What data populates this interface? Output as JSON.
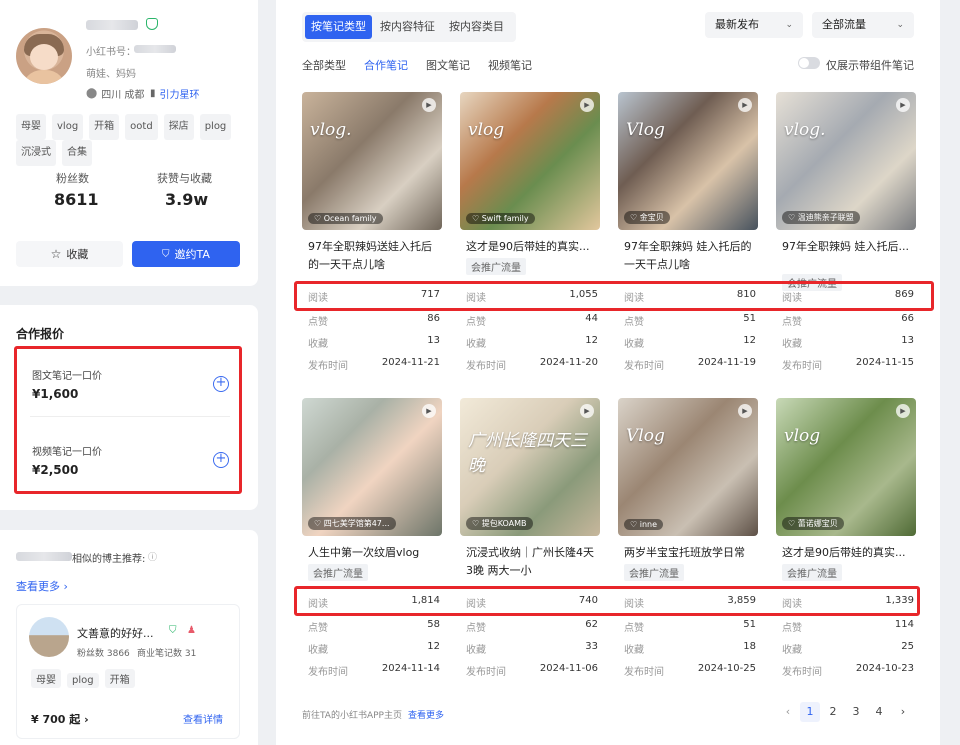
{
  "profile": {
    "id_label": "小红书号：",
    "bio": "萌娃、妈妈",
    "location": "四川 成都",
    "star_label": "引力星环",
    "tags": [
      "母婴",
      "vlog",
      "开箱",
      "ootd",
      "探店",
      "plog",
      "沉浸式",
      "合集"
    ],
    "fans_label": "粉丝数",
    "fans_value": "8611",
    "likes_label": "获赞与收藏",
    "likes_value": "3.9w",
    "collect_btn": "收藏",
    "invite_btn": "邀约TA"
  },
  "quote": {
    "title": "合作报价",
    "items": [
      {
        "label": "图文笔记一口价",
        "price": "¥1,600"
      },
      {
        "label": "视频笔记一口价",
        "price": "¥2,500"
      }
    ]
  },
  "recommend": {
    "title_suffix": "相似的博主推荐:",
    "see_more": "查看更多 ›",
    "blogger": {
      "name": "文善意的好好...",
      "fans": "粉丝数 3866",
      "notes": "商业笔记数 31",
      "tags": [
        "母婴",
        "plog",
        "开箱"
      ],
      "price": "¥ 700 起 ›",
      "details": "查看详情"
    }
  },
  "main": {
    "seg_tabs": [
      "按笔记类型",
      "按内容特征",
      "按内容类目"
    ],
    "sort_dropdown": "最新发布",
    "traffic_dropdown": "全部流量",
    "sub_tabs": [
      "全部类型",
      "合作笔记",
      "图文笔记",
      "视频笔记"
    ],
    "toggle_label": "仅展示带组件笔记",
    "stat_labels": [
      "阅读",
      "点赞",
      "收藏",
      "发布时间"
    ],
    "notes": [
      {
        "title": "97年全职辣妈送娃入托后的一天干点儿啥",
        "badge": "",
        "author": "Ocean family",
        "overlay": "vlog.",
        "read": "717",
        "like": "86",
        "fav": "13",
        "date": "2024-11-21"
      },
      {
        "title": "这才是90后带娃的真实...",
        "badge": "会推广流量",
        "author": "Swift family",
        "overlay": "vlog",
        "read": "1,055",
        "like": "44",
        "fav": "12",
        "date": "2024-11-20"
      },
      {
        "title": "97年全职辣妈 娃入托后的一天干点儿啥",
        "badge": "",
        "author": "金宝贝",
        "overlay": "Vlog",
        "read": "810",
        "like": "51",
        "fav": "12",
        "date": "2024-11-19"
      },
      {
        "title": "97年全职辣妈 娃入托后...",
        "badge": "会推广流量",
        "author": "温迪熊亲子联盟",
        "overlay": "vlog.",
        "read": "869",
        "like": "66",
        "fav": "13",
        "date": "2024-11-15"
      },
      {
        "title": "人生中第一次纹眉vlog",
        "badge": "会推广流量",
        "author": "四七美学馆第47...",
        "overlay": "",
        "read": "1,814",
        "like": "58",
        "fav": "12",
        "date": "2024-11-14"
      },
      {
        "title": "沉浸式收纳｜广州长隆4天3晚 两大一小",
        "badge": "",
        "author": "提包KOAMB",
        "overlay": "广州长隆四天三晚",
        "read": "740",
        "like": "62",
        "fav": "33",
        "date": "2024-11-06"
      },
      {
        "title": "两岁半宝宝托班放学日常",
        "badge": "会推广流量",
        "author": "inne",
        "overlay": "Vlog",
        "read": "3,859",
        "like": "51",
        "fav": "18",
        "date": "2024-10-25"
      },
      {
        "title": "这才是90后带娃的真实...",
        "badge": "会推广流量",
        "author": "蕾诺娜宝贝",
        "overlay": "vlog",
        "read": "1,339",
        "like": "114",
        "fav": "25",
        "date": "2024-10-23"
      }
    ],
    "footer_text": "前往TA的小红书APP主页",
    "footer_link": "查看更多",
    "pages": [
      "1",
      "2",
      "3",
      "4"
    ],
    "prev": "‹",
    "next": "›"
  },
  "colors": {
    "accent": "#2f63f0",
    "highlight": "#e8262a"
  }
}
